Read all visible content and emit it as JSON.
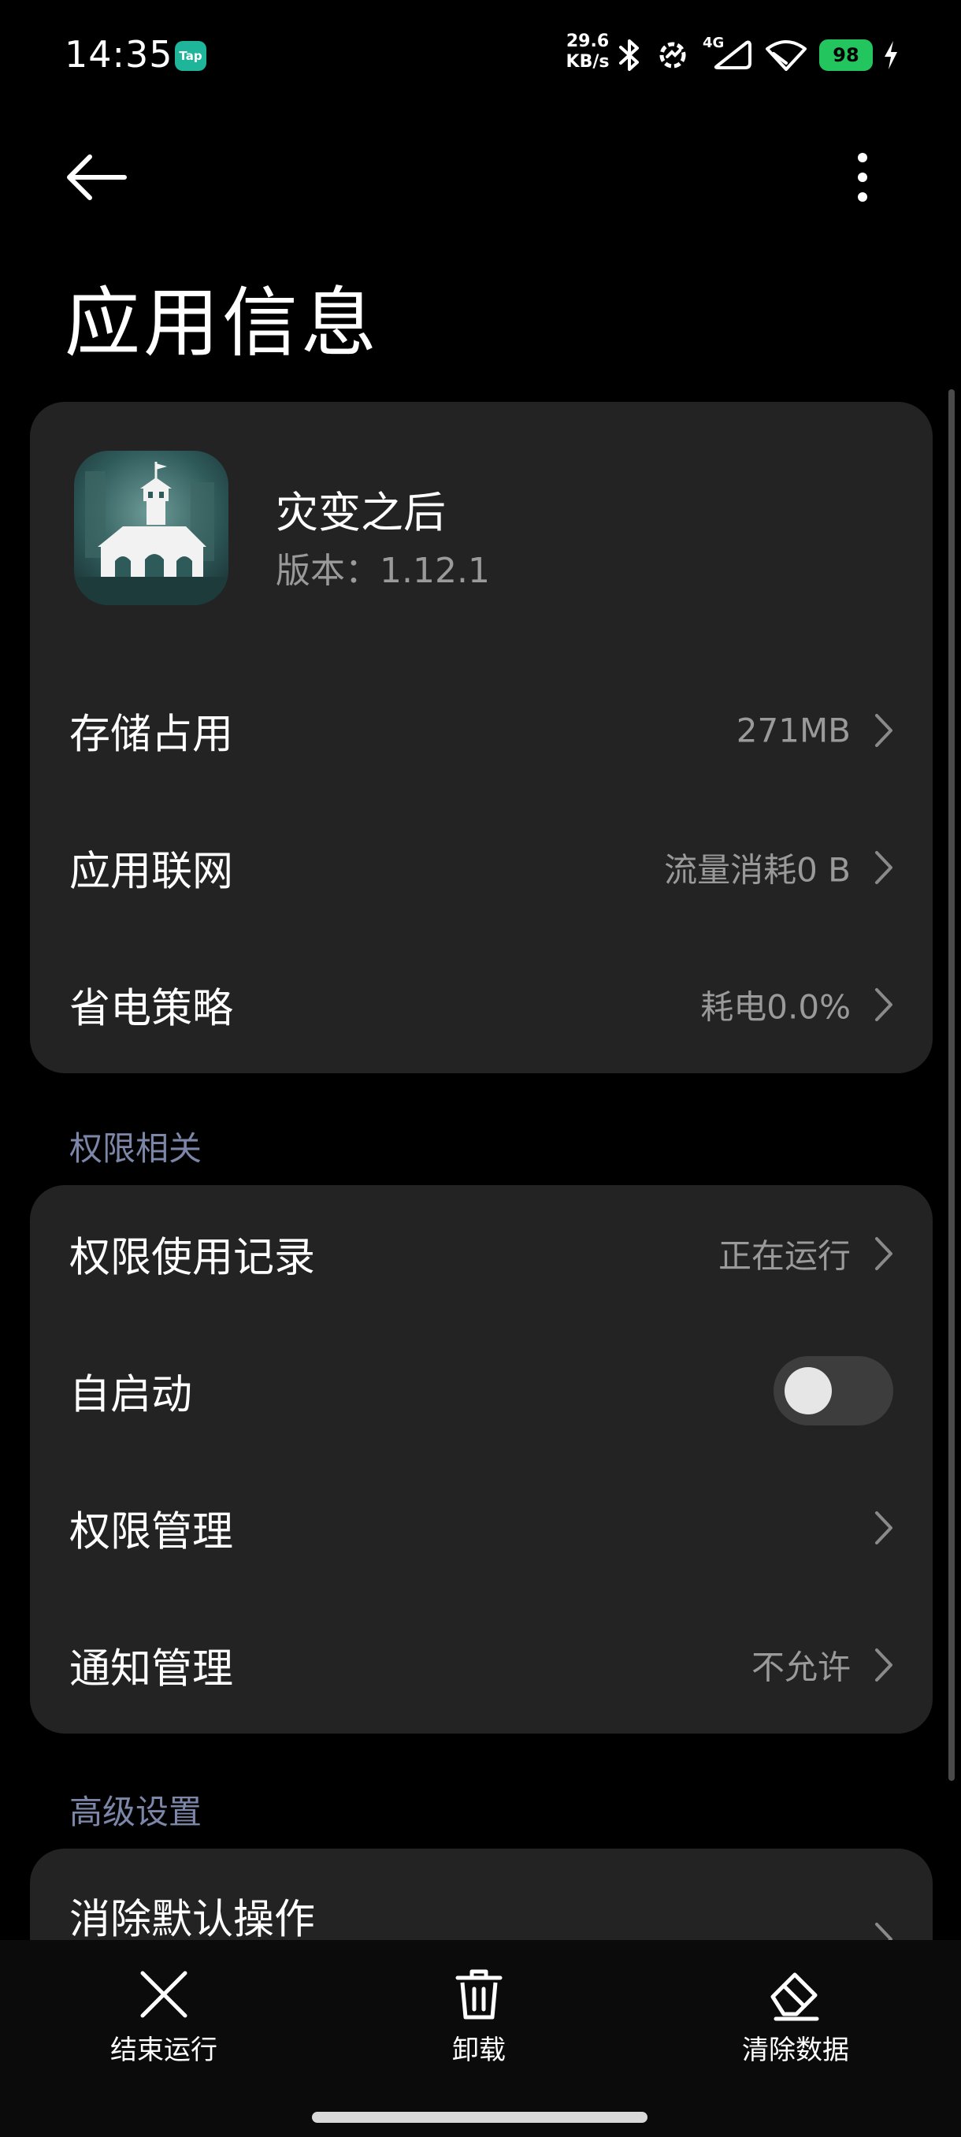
{
  "status_bar": {
    "time": "14:35",
    "notification_badge": "Tap",
    "net_speed_value": "29.6",
    "net_speed_unit": "KB/s",
    "signal_label": "4G",
    "battery_level": "98",
    "icons": [
      "bluetooth-icon",
      "network-activity-icon",
      "mobile-signal-icon",
      "wifi-icon",
      "battery-icon",
      "charging-icon"
    ]
  },
  "header": {
    "title": "应用信息",
    "back_icon": "back-arrow-icon",
    "more_icon": "more-vertical-icon"
  },
  "app": {
    "name": "灾变之后",
    "version": "版本：1.12.1"
  },
  "main_rows": [
    {
      "label": "存储占用",
      "value": "271MB"
    },
    {
      "label": "应用联网",
      "value": "流量消耗0 B"
    },
    {
      "label": "省电策略",
      "value": "耗电0.0%"
    }
  ],
  "permissions": {
    "section_title": "权限相关",
    "rows": [
      {
        "label": "权限使用记录",
        "value": "正在运行"
      },
      {
        "label": "自启动",
        "toggle_on": false
      },
      {
        "label": "权限管理",
        "value": ""
      },
      {
        "label": "通知管理",
        "value": "不允许"
      }
    ]
  },
  "advanced": {
    "section_title": "高级设置",
    "rows": [
      {
        "label": "消除默认操作"
      }
    ]
  },
  "bottom_actions": [
    {
      "label": "结束运行",
      "icon": "close-icon"
    },
    {
      "label": "卸载",
      "icon": "trash-icon"
    },
    {
      "label": "清除数据",
      "icon": "eraser-icon"
    }
  ],
  "colors": {
    "background": "#000000",
    "card": "#232323",
    "secondary_text": "#9a9a9a",
    "section_label": "#7b86a8",
    "battery": "#22c55e",
    "toggle_track": "#3d3d3d"
  }
}
